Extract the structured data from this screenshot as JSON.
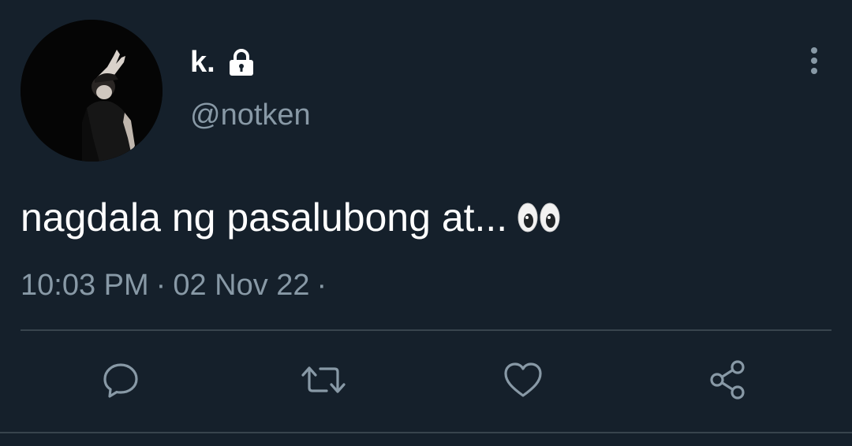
{
  "tweet": {
    "display_name": "k.",
    "handle": "@notken",
    "text": "nagdala ng pasalubong at...",
    "time": "10:03 PM",
    "date": "02 Nov 22",
    "separator": "·",
    "protected_icon": "lock-icon",
    "emoji_icon": "eyes-emoji"
  },
  "actions": {
    "reply_icon": "reply-icon",
    "retweet_icon": "retweet-icon",
    "like_icon": "heart-icon",
    "share_icon": "share-icon"
  },
  "menu_icon": "more-vertical-icon",
  "colors": {
    "background": "#15202b",
    "primary_text": "#ffffff",
    "secondary_text": "#8899a6",
    "divider": "#38444d",
    "icon": "#8899a6"
  }
}
